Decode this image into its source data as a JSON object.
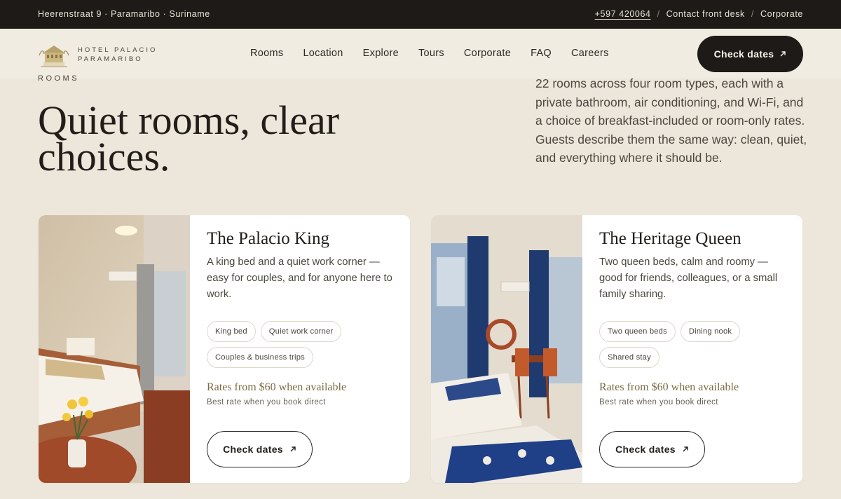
{
  "topbar": {
    "address": "Heerenstraat 9 · Paramaribo · Suriname",
    "phone": "+597 420064",
    "separator": "/",
    "contact": "Contact front desk",
    "corporate": "Corporate"
  },
  "brand": {
    "line1": "HOTEL PALACIO",
    "line2": "PARAMARIBO",
    "logo_icon": "hotel-building-crest-icon"
  },
  "nav": {
    "items": [
      "Rooms",
      "Location",
      "Explore",
      "Tours",
      "Corporate",
      "FAQ",
      "Careers"
    ],
    "cta_label": "Check dates",
    "cta_icon": "arrow-up-right-icon"
  },
  "hero": {
    "eyebrow": "ROOMS",
    "headline": "Quiet rooms, clear choices.",
    "intro": "22 rooms across four room types, each with a private bathroom, air conditioning, and Wi-Fi, and a choice of breakfast-included or room-only rates. Guests describe them the same way: clean, quiet, and everything where it should be."
  },
  "rooms": [
    {
      "title": "The Palacio King",
      "description": "A king bed and a quiet work corner — easy for couples, and for anyone here to work.",
      "tags": [
        "King bed",
        "Quiet work corner",
        "Couples & business trips"
      ],
      "rate": "Rates from $60 when available",
      "rate_note": "Best rate when you book direct",
      "button_label": "Check dates"
    },
    {
      "title": "The Heritage Queen",
      "description": "Two queen beds, calm and roomy — good for friends, colleagues, or a small family sharing.",
      "tags": [
        "Two queen beds",
        "Dining nook",
        "Shared stay"
      ],
      "rate": "Rates from $60 when available",
      "rate_note": "Best rate when you book direct",
      "button_label": "Check dates"
    }
  ],
  "colors": {
    "page_bg": "#ede6da",
    "dark": "#1d1a17",
    "rate_gold": "#7b6a42",
    "card_bg": "#ffffff"
  }
}
